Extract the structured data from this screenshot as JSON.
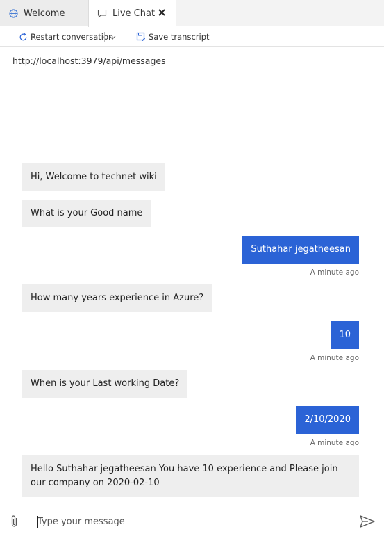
{
  "tabs": [
    {
      "label": "Welcome",
      "icon": "globe-icon"
    },
    {
      "label": "Live Chat",
      "icon": "chat-bubble-icon"
    }
  ],
  "toolbar": {
    "restart_label": "Restart conversation",
    "save_label": "Save transcript"
  },
  "endpoint_url": "http://localhost:3979/api/messages",
  "messages": [
    {
      "from": "bot",
      "text": "Hi, Welcome to technet wiki"
    },
    {
      "from": "bot",
      "text": "What is your Good name"
    },
    {
      "from": "user",
      "text": "Suthahar jegatheesan",
      "time": "A minute ago"
    },
    {
      "from": "bot",
      "text": "How many years experience in Azure?"
    },
    {
      "from": "user",
      "text": "10",
      "time": "A minute ago"
    },
    {
      "from": "bot",
      "text": "When is your Last working Date?"
    },
    {
      "from": "user",
      "text": "2/10/2020",
      "time": "A minute ago"
    },
    {
      "from": "bot",
      "text": "Hello Suthahar jegatheesan You have 10 experience and Please join our company on 2020-02-10"
    }
  ],
  "composer": {
    "placeholder": "Type your message"
  },
  "colors": {
    "user_bubble": "#2b63d6",
    "bot_bubble": "#eeeeee"
  }
}
